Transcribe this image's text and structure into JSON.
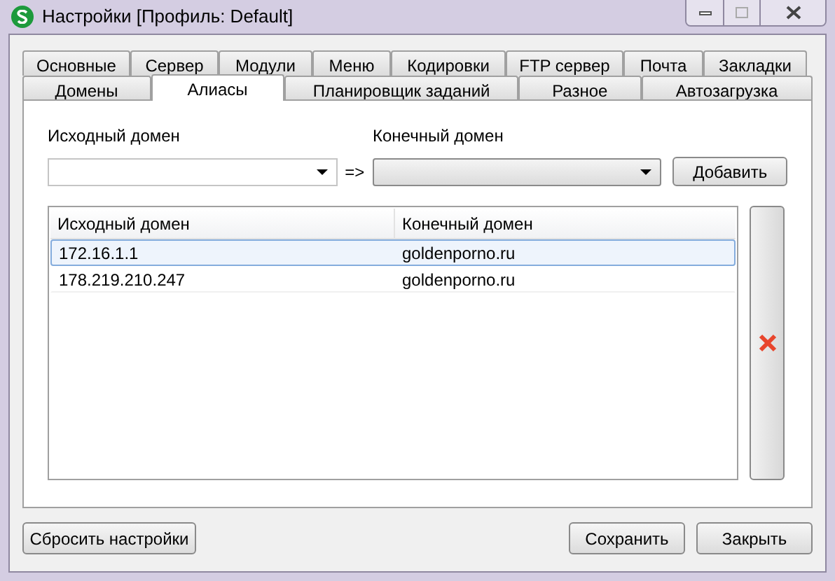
{
  "window": {
    "title": "Настройки [Профиль: Default]"
  },
  "tab_rows": [
    [
      {
        "label": "Основные",
        "selected": false
      },
      {
        "label": "Сервер",
        "selected": false
      },
      {
        "label": "Модули",
        "selected": false
      },
      {
        "label": "Меню",
        "selected": false
      },
      {
        "label": "Кодировки",
        "selected": false
      },
      {
        "label": "FTP сервер",
        "selected": false
      },
      {
        "label": "Почта",
        "selected": false
      },
      {
        "label": "Закладки",
        "selected": false
      }
    ],
    [
      {
        "label": "Домены",
        "selected": false
      },
      {
        "label": "Алиасы",
        "selected": true
      },
      {
        "label": "Планировщик заданий",
        "selected": false
      },
      {
        "label": "Разное",
        "selected": false
      },
      {
        "label": "Автозагрузка",
        "selected": false
      }
    ]
  ],
  "source_label": "Исходный домен",
  "target_label": "Конечный домен",
  "arrow": "=>",
  "add_button": "Добавить",
  "table": {
    "columns": [
      "Исходный домен",
      "Конечный домен"
    ],
    "rows": [
      {
        "cells": [
          "172.16.1.1",
          "goldenporno.ru"
        ],
        "selected": true
      },
      {
        "cells": [
          "178.219.210.247",
          "goldenporno.ru"
        ],
        "selected": false
      }
    ]
  },
  "buttons": {
    "reset": "Сбросить настройки",
    "save": "Сохранить",
    "close": "Закрыть"
  }
}
